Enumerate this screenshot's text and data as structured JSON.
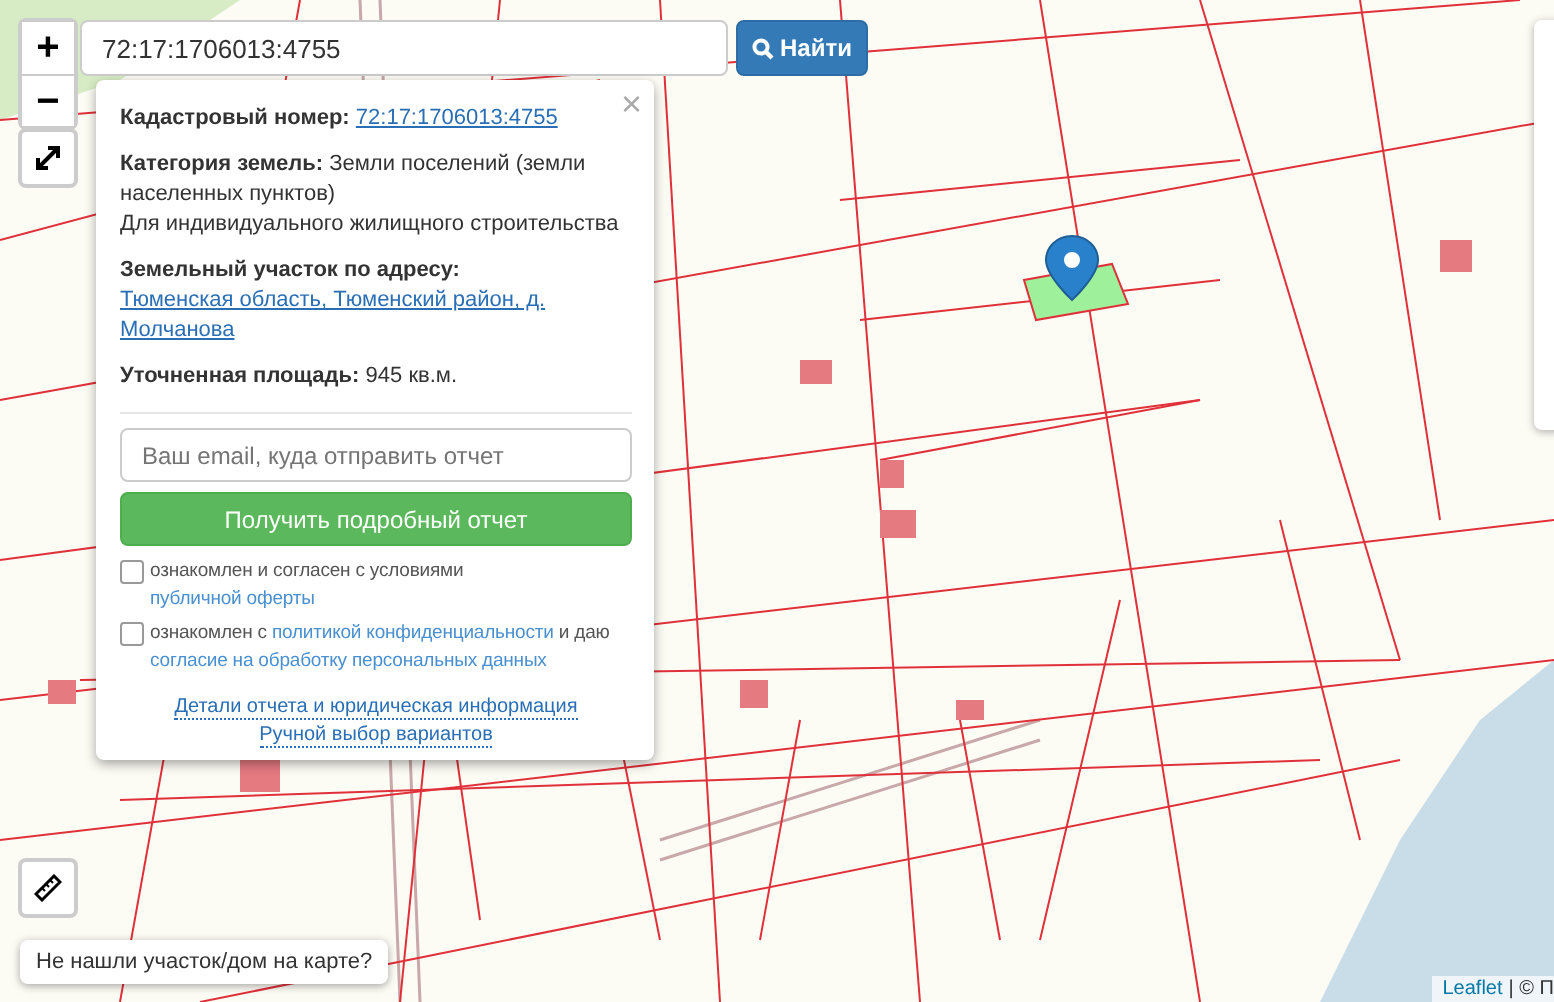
{
  "search": {
    "value": "72:17:1706013:4755",
    "button": "Найти"
  },
  "zoom_controls": {
    "zoom_in": "+",
    "zoom_out": "−"
  },
  "popup": {
    "close": "×",
    "cadastral_number": {
      "label": "Кадастровый номер:",
      "value": "72:17:1706013:4755"
    },
    "category": {
      "label": "Категория земель:",
      "value": "Земли поселений (земли населенных пунктов)",
      "use": "Для индивидуального жилищного строительства"
    },
    "address": {
      "label": "Земельный участок по адресу:",
      "value": "Тюменская область, Тюменский район, д. Молчанова"
    },
    "area": {
      "label": "Уточненная площадь:",
      "value": "945 кв.м."
    },
    "email": {
      "placeholder": "Ваш email, куда отправить отчет"
    },
    "submit": "Получить подробный отчет",
    "agreements": [
      {
        "checked": false,
        "parts": [
          {
            "kind": "text",
            "text": "ознакомлен и согласен с условиями"
          },
          {
            "kind": "link",
            "text": "публичной оферты"
          }
        ]
      },
      {
        "checked": false,
        "parts": [
          {
            "kind": "text",
            "text": "ознакомлен с"
          },
          {
            "kind": "link",
            "text": "политикой конфиденциальности"
          },
          {
            "kind": "text",
            "text": "и даю"
          },
          {
            "kind": "link",
            "text": "согласие на обработку персональных данных"
          }
        ]
      }
    ],
    "links": [
      "Детали отчета и юридическая информация",
      "Ручной выбор вариантов"
    ]
  },
  "not_found_button": "Не нашли участок/дом на карте?",
  "attribution": {
    "link": "Leaflet",
    "rest": "| © П"
  }
}
